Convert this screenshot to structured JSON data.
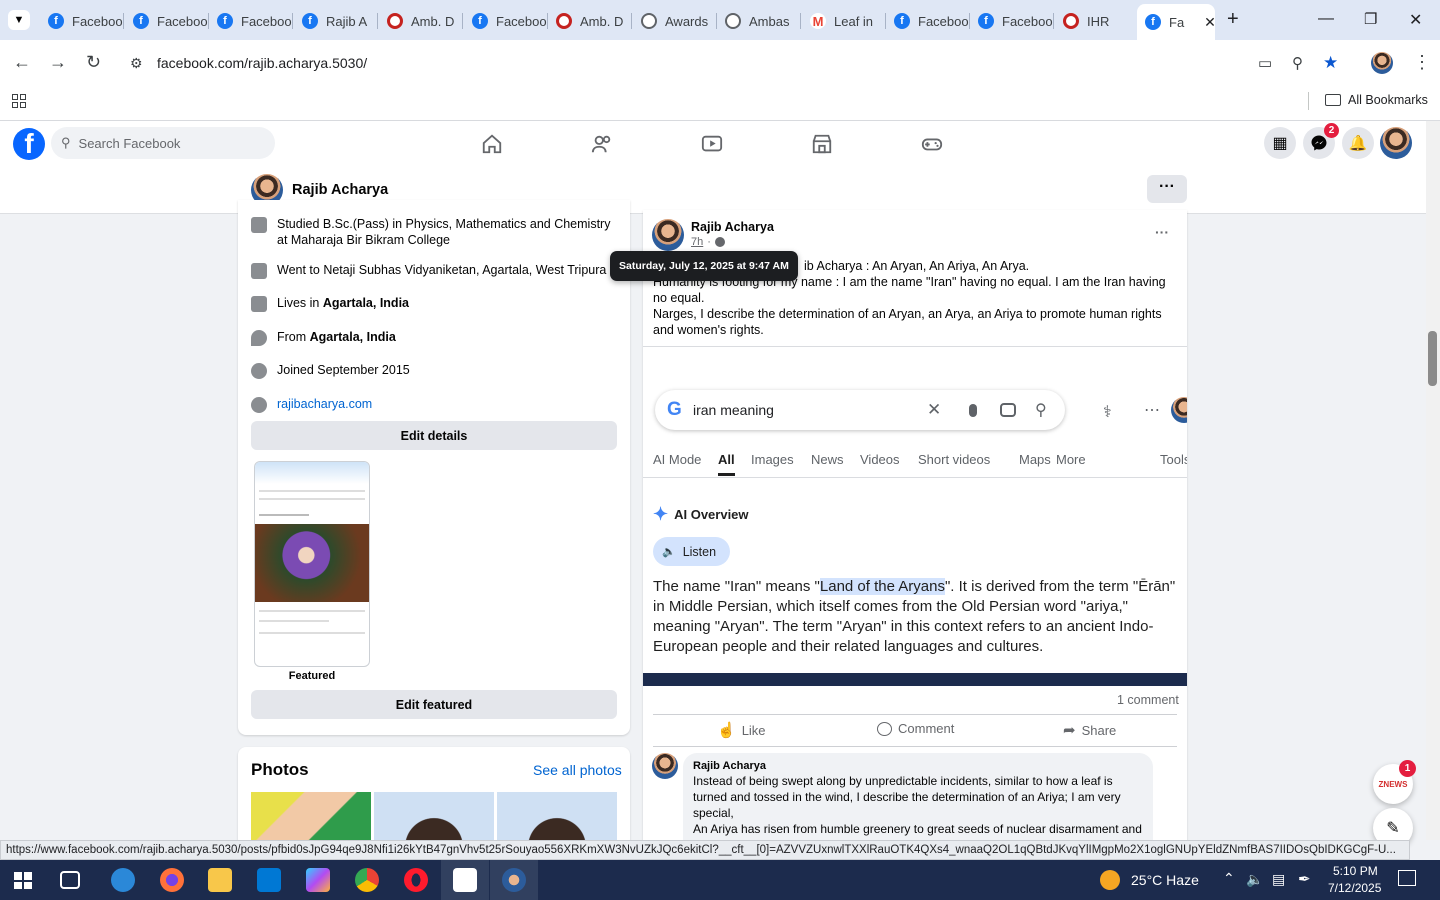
{
  "browser": {
    "tabs": [
      {
        "label": "Facebook",
        "icon": "fb"
      },
      {
        "label": "Facebook",
        "icon": "fb"
      },
      {
        "label": "Facebook",
        "icon": "fb"
      },
      {
        "label": "Rajib A",
        "icon": "fb"
      },
      {
        "label": "Amb. D",
        "icon": "amb"
      },
      {
        "label": "Facebook",
        "icon": "fb"
      },
      {
        "label": "Amb. D",
        "icon": "amb"
      },
      {
        "label": "Awards",
        "icon": "globe"
      },
      {
        "label": "Ambas",
        "icon": "globe"
      },
      {
        "label": "Leaf in",
        "icon": "gm"
      },
      {
        "label": "Facebook",
        "icon": "fb"
      },
      {
        "label": "Facebook",
        "icon": "fb"
      },
      {
        "label": "IHR",
        "icon": "amb"
      }
    ],
    "active_tab": {
      "label": "Fa",
      "icon": "fb"
    },
    "url": "facebook.com/rajib.acharya.5030/",
    "bookmarks_label": "All Bookmarks"
  },
  "fb": {
    "search_placeholder": "Search Facebook",
    "notification_count": "2",
    "profile_name": "Rajib Acharya"
  },
  "intro": {
    "items": [
      {
        "text": "Studied B.Sc.(Pass) in Physics, Mathematics and Chemistry at Maharaja Bir Bikram College"
      },
      {
        "text": "Went to Netaji Subhas Vidyaniketan, Agartala, West Tripura"
      },
      {
        "pre": "Lives in ",
        "bold": "Agartala, India"
      },
      {
        "pre": "From ",
        "bold": "Agartala, India"
      },
      {
        "text": "Joined September 2015"
      },
      {
        "link": "rajibacharya.com"
      }
    ],
    "edit_details": "Edit details",
    "featured_label": "Featured",
    "edit_featured": "Edit featured"
  },
  "photos": {
    "title": "Photos",
    "see_all": "See all photos"
  },
  "post": {
    "author": "Rajib Acharya",
    "time": "7h",
    "tooltip": "Saturday, July 12, 2025 at 9:47 AM",
    "text_line1_visible": "ib Acharya : An Aryan, An Ariya, An Arya.",
    "text_line2": "Humanity is footing  for my name : I am the name \"Iran\" having no equal. I am the Iran having no equal.",
    "text_line3": "Narges, I describe the determination of an Aryan, an Arya, an Ariya to promote human rights and women's rights.",
    "google": {
      "query": "iran meaning",
      "tabs": [
        "AI Mode",
        "All",
        "Images",
        "News",
        "Videos",
        "Short videos",
        "Maps",
        "More",
        "Tools"
      ],
      "active_tab": "All",
      "ai_overview": "AI Overview",
      "listen": "Listen",
      "answer_pre": "The name \"Iran\" means \"",
      "answer_highlight": "Land of the Aryans",
      "answer_post": "\". It is derived from the term \"Ērān\" in Middle Persian, which itself comes from the Old Persian word \"ariya,\" meaning \"Aryan\". The term \"Aryan\" in this context refers to an ancient Indo-European people and their related languages and cultures."
    },
    "comment_count": "1 comment",
    "actions": {
      "like": "Like",
      "comment": "Comment",
      "share": "Share"
    },
    "comment": {
      "author": "Rajib Acharya",
      "text": "Instead of being swept along by unpredictable incidents, similar to how a leaf is turned and tossed in the wind, I describe the determination of an Ariya; I am very special,",
      "text2": "An Ariya has risen from humble greenery to great seeds of nuclear disarmament and"
    }
  },
  "chat_badge": "1",
  "chat_label": "ZNEWS",
  "status_url": "https://www.facebook.com/rajib.acharya.5030/posts/pfbid0sJpG94qe9J8Nfi1i26kYtB47gnVhv5t25rSouyao556XRKmXW3NvUZkJQc6ekitCl?__cft__[0]=AZVVZUxnwlTXXlRauOTK4QXs4_wnaaQ2OL1qQBtdJKvqYlIMgpMo2X1oglGNUpYEldZNmfBAS7IIDOsQbIDKGCgF-U...",
  "taskbar": {
    "weather": "25°C  Haze",
    "time": "5:10 PM",
    "date": "7/12/2025"
  }
}
